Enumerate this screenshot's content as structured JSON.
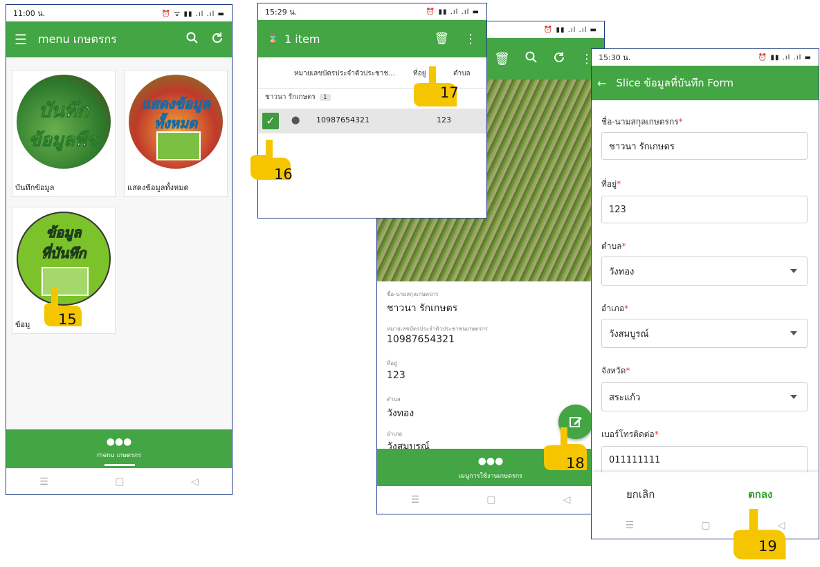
{
  "screen1": {
    "status_time": "11:00 น.",
    "status_icons": "⏰ ᯤ ▮▮ .ıl .ıl ▬",
    "app_title": "menu เกษตรกร",
    "tiles": [
      {
        "image_text_1": "บันทึก",
        "image_text_2": "ข้อมูลพืช",
        "label": "บันทึกข้อมูล"
      },
      {
        "image_text_1": "แสดงข้อมูล",
        "image_text_2": "ทั้งหมด",
        "label": "แสดงข้อมูลทั้งหมด"
      },
      {
        "image_text_1": "ข้อมูล",
        "image_text_2": "ที่บันทึก",
        "label": "ข้อมู"
      }
    ],
    "bottom_nav_label": "menu เกษตรกร"
  },
  "screen2": {
    "status_time": "15:29 น.",
    "status_icons": "⏰ ▮▮ .ıl .ıl ▬",
    "selection_title": "1 item",
    "columns": [
      "หมายเลขบัตรประจำตัวประชาช...",
      "ที่อยู่",
      "ตำบล"
    ],
    "group_label": "ชาวนา รักเกษตร",
    "group_count": "1",
    "row": {
      "id": "10987654321",
      "address": "123"
    }
  },
  "screen3": {
    "status_icons": "⏰ ▮▮ .ıl .ıl ▬",
    "details": [
      {
        "label": "ชื่อ-นามสกุลเกษตรกร",
        "value": "ชาวนา รักเกษตร"
      },
      {
        "label": "หมายเลขบัตรประจำตัวประชาชนเกษตรกร",
        "value": "10987654321"
      },
      {
        "label": "ที่อยู่",
        "value": "123"
      },
      {
        "label": "ตำบล",
        "value": "วังทอง"
      },
      {
        "label": "อำเภอ",
        "value": "วังสมบูรณ์"
      }
    ],
    "bottom_nav_label": "เมนูการใช้งานเกษตรกร"
  },
  "screen4": {
    "status_time": "15:30 น.",
    "status_icons": "⏰ ▮▮ .ıl .ıl ▬",
    "form_title": "Slice ข้อมูลที่บันทึก Form",
    "fields": [
      {
        "label": "ชื่อ-นามสกุลเกษตรกร",
        "value": "ชาวนา รักเกษตร"
      },
      {
        "label": "ที่อยู่",
        "value": "123"
      },
      {
        "label": "ตำบล",
        "value": "วังทอง"
      },
      {
        "label": "อำเภอ",
        "value": "วังสมบูรณ์"
      },
      {
        "label": "จังหวัด",
        "value": "สระแก้ว"
      },
      {
        "label": "เบอร์โทรติดต่อ",
        "value": "011111111"
      }
    ],
    "required_mark": "*",
    "cancel_label": "ยกเลิก",
    "ok_label": "ตกลง"
  },
  "steps": [
    "15",
    "16",
    "17",
    "18",
    "19"
  ],
  "colors": {
    "accent": "#43a543",
    "hand": "#f5c500",
    "frame": "#1f3b86"
  }
}
